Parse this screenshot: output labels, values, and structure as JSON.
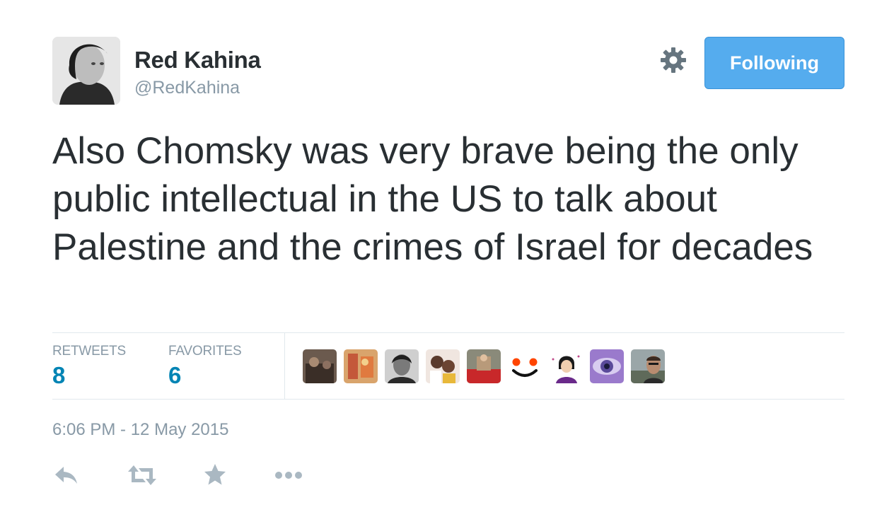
{
  "user": {
    "name": "Red Kahina",
    "handle": "@RedKahina"
  },
  "follow_button": {
    "label": "Following"
  },
  "tweet": {
    "text": "Also Chomsky was very brave being the only public intellectual in the US to talk about Palestine and the crimes of Israel for decades"
  },
  "stats": {
    "retweets_label": "RETWEETS",
    "retweets_count": "8",
    "favorites_label": "FAVORITES",
    "favorites_count": "6"
  },
  "timestamp": "6:06 PM - 12 May 2015",
  "colors": {
    "accent": "#55acee",
    "link": "#0084b4",
    "muted": "#8899a6",
    "text": "#292f33",
    "divider": "#e1e8ed"
  },
  "icons": {
    "settings": "gear-icon",
    "reply": "reply-icon",
    "retweet": "retweet-icon",
    "favorite": "star-icon",
    "more": "more-icon"
  }
}
